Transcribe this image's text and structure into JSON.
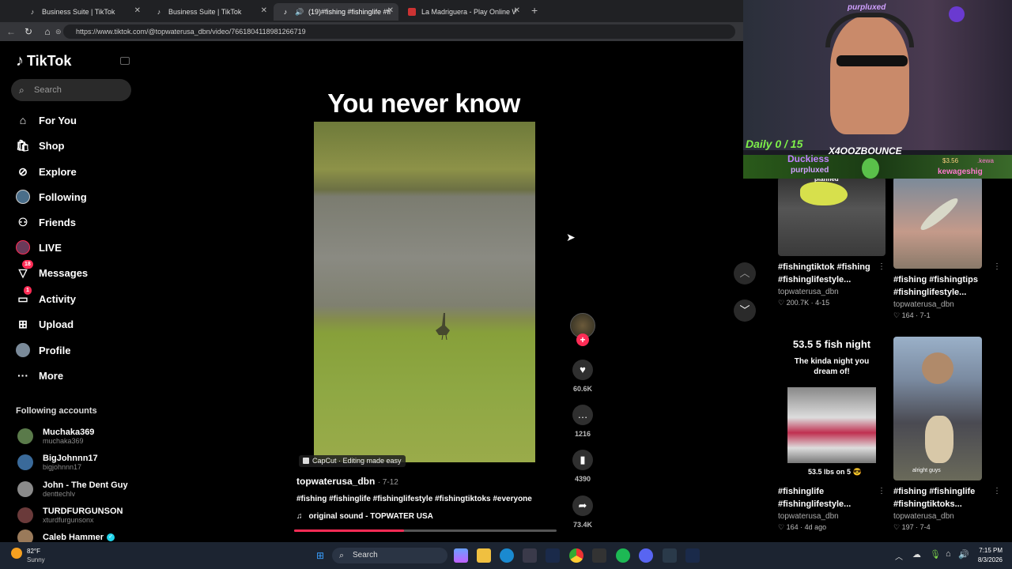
{
  "browser": {
    "tabs": [
      {
        "title": "Business Suite | TikTok"
      },
      {
        "title": "Business Suite | TikTok"
      },
      {
        "title": "(19)#fishing #fishinglife #fishi"
      },
      {
        "title": "La Madriguera - Play Online With"
      }
    ],
    "url": "https://www.tiktok.com/@topwaterusa_dbn/video/7661804118981266719"
  },
  "sidebar": {
    "logo": "TikTok",
    "search_placeholder": "Search",
    "items": [
      {
        "label": "For You",
        "icon": "home-icon"
      },
      {
        "label": "Shop",
        "icon": "shop-icon"
      },
      {
        "label": "Explore",
        "icon": "compass-icon"
      },
      {
        "label": "Following",
        "icon": "avatar-icon"
      },
      {
        "label": "Friends",
        "icon": "friends-icon"
      },
      {
        "label": "LIVE",
        "icon": "live-icon"
      },
      {
        "label": "Messages",
        "icon": "messages-icon",
        "badge": "18"
      },
      {
        "label": "Activity",
        "icon": "activity-icon",
        "badge": "1"
      },
      {
        "label": "Upload",
        "icon": "upload-icon"
      },
      {
        "label": "Profile",
        "icon": "profile-icon"
      },
      {
        "label": "More",
        "icon": "more-icon"
      }
    ],
    "following_header": "Following accounts",
    "accounts": [
      {
        "name": "Muchaka369",
        "handle": "muchaka369"
      },
      {
        "name": "BigJohnnn17",
        "handle": "bigjohnnn17"
      },
      {
        "name": "John - The Dent Guy",
        "handle": "denttechlv"
      },
      {
        "name": "TURDFURGUNSON",
        "handle": "xturdfurgunsonx"
      },
      {
        "name": "Caleb Hammer",
        "handle": ""
      }
    ]
  },
  "video": {
    "overlay_title": "You never know",
    "capcut": "CapCut · Editing made easy",
    "author": "topwaterusa_dbn",
    "date": "· 7-12",
    "hashtags": "#fishing #fishinglife #fishinglifestyle #fishingtiktoks #everyone",
    "sound": "original sound - TOPWATER USA",
    "progress": 0.42,
    "likes": "60.6K",
    "comments": "1216",
    "saves": "4390",
    "shares": "73.4K"
  },
  "right_grid": [
    {
      "caption": "#fishingtiktok #fishing #fishinglifestyle...",
      "author": "topwaterusa_dbn",
      "stats": "200.7K · 4-15",
      "thumb_text": "planned"
    },
    {
      "caption": "#fishing #fishingtips #fishinglifestyle...",
      "author": "topwaterusa_dbn",
      "stats": "164 · 7-1",
      "thumb_text": ""
    },
    {
      "caption": "#fishinglife #fishinglifestyle...",
      "author": "topwaterusa_dbn",
      "stats": "164 · 4d ago",
      "thumb_text": "53.5  5 fish night",
      "thumb_sub": "The kinda night you dream of!",
      "thumb_bottom": "53.5 lbs on 5 😎"
    },
    {
      "caption": "#fishing #fishinglife #fishingtiktoks...",
      "author": "topwaterusa_dbn",
      "stats": "197 · 7-4",
      "thumb_text": "",
      "thumb_bottom": "alright guys"
    }
  ],
  "stream_overlay": {
    "top_name": "purpluxed",
    "daily": "Daily 0 / 15",
    "channel": "X4OOZBOUNCE",
    "name1": "Duckiess",
    "name2": "purpluxed",
    "name3": "kewageshig",
    "points": "$3.56",
    "tag": ".kewa"
  },
  "taskbar": {
    "weather_temp": "82°F",
    "weather_desc": "Sunny",
    "search": "Search",
    "time": "7:15 PM",
    "date": "8/3/2026"
  },
  "colors": {
    "accent": "#fe2c55",
    "background": "#000000",
    "taskbar": "#1c2431"
  }
}
